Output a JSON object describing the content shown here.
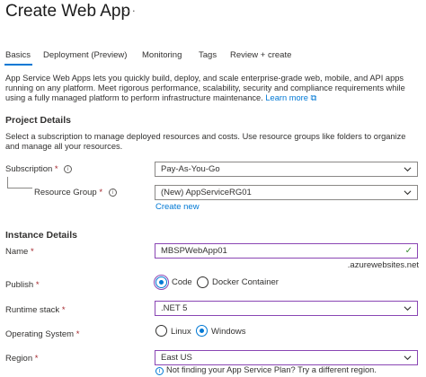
{
  "header": {
    "title": "Create Web App",
    "more_label": "···"
  },
  "tabs": [
    "Basics",
    "Deployment (Preview)",
    "Monitoring",
    "Tags",
    "Review + create"
  ],
  "intro": {
    "text": "App Service Web Apps lets you quickly build, deploy, and scale enterprise-grade web, mobile, and API apps running on any platform. Meet rigorous performance, scalability, security and compliance requirements while using a fully managed platform to perform infrastructure maintenance.",
    "link": "Learn more"
  },
  "project": {
    "heading": "Project Details",
    "text": "Select a subscription to manage deployed resources and costs. Use resource groups like folders to organize and manage all your resources.",
    "subscription": {
      "label": "Subscription",
      "value": "Pay-As-You-Go"
    },
    "resource_group": {
      "label": "Resource Group",
      "value": "(New) AppServiceRG01",
      "create_link": "Create new"
    }
  },
  "instance": {
    "heading": "Instance Details",
    "name": {
      "label": "Name",
      "value": "MBSPWebApp01",
      "suffix": ".azurewebsites.net"
    },
    "publish": {
      "label": "Publish",
      "options": [
        "Code",
        "Docker Container"
      ],
      "selected": "Code"
    },
    "runtime": {
      "label": "Runtime stack",
      "value": ".NET 5"
    },
    "os": {
      "label": "Operating System",
      "options": [
        "Linux",
        "Windows"
      ],
      "selected": "Windows"
    },
    "region": {
      "label": "Region",
      "value": "East US",
      "hint": "Not finding your App Service Plan? Try a different region."
    }
  },
  "required_mark": "*",
  "info_glyph": "i",
  "colors": {
    "accent": "#0078d4",
    "focus_border": "#8a46b4",
    "required": "#a4262c",
    "valid": "#3d8f37"
  }
}
